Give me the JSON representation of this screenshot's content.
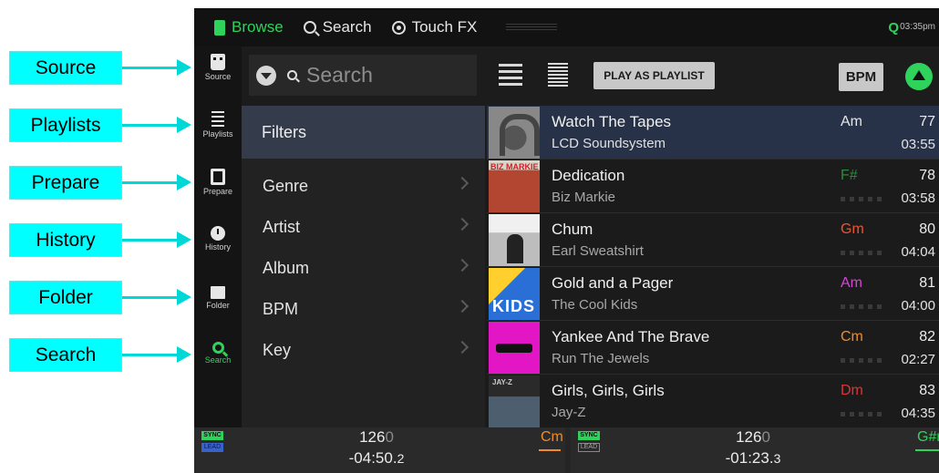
{
  "callouts": [
    {
      "label": "Source"
    },
    {
      "label": "Playlists"
    },
    {
      "label": "Prepare"
    },
    {
      "label": "History"
    },
    {
      "label": "Folder"
    },
    {
      "label": "Search"
    }
  ],
  "topbar": {
    "tabs": [
      {
        "label": "Browse",
        "icon": "library-icon"
      },
      {
        "label": "Search",
        "icon": "search-icon"
      },
      {
        "label": "Touch FX",
        "icon": "touch-fx-icon"
      }
    ],
    "quantize": "Q",
    "clock": "03:35pm"
  },
  "nav": {
    "items": [
      {
        "label": "Source",
        "icon": "source-icon"
      },
      {
        "label": "Playlists",
        "icon": "playlists-icon"
      },
      {
        "label": "Prepare",
        "icon": "prepare-icon"
      },
      {
        "label": "History",
        "icon": "history-icon"
      },
      {
        "label": "Folder",
        "icon": "folder-icon"
      },
      {
        "label": "Search",
        "icon": "search-icon",
        "active": true
      }
    ]
  },
  "toolbar": {
    "search_placeholder": "Search",
    "play_as_playlist": "PLAY AS PLAYLIST",
    "sort_label": "BPM"
  },
  "filters": {
    "title": "Filters",
    "items": [
      {
        "label": "Genre"
      },
      {
        "label": "Artist"
      },
      {
        "label": "Album"
      },
      {
        "label": "BPM"
      },
      {
        "label": "Key"
      }
    ]
  },
  "tracks": [
    {
      "title": "Watch The Tapes",
      "artist": "LCD Soundsystem",
      "key": "Am",
      "key_color": "#e6e6e6",
      "bpm": "77",
      "time": "03:55",
      "selected": true,
      "art_text": ""
    },
    {
      "title": "Dedication",
      "artist": "Biz Markie",
      "key": "F#",
      "key_color": "#2a8c3c",
      "bpm": "78",
      "time": "03:58",
      "selected": false,
      "art_text": "BIZ MARKIE"
    },
    {
      "title": "Chum",
      "artist": "Earl Sweatshirt",
      "key": "Gm",
      "key_color": "#e8562e",
      "bpm": "80",
      "time": "04:04",
      "selected": false,
      "art_text": ""
    },
    {
      "title": "Gold and a Pager",
      "artist": "The Cool Kids",
      "key": "Am",
      "key_color": "#d048d6",
      "bpm": "81",
      "time": "04:00",
      "selected": false,
      "art_text": "KIDS"
    },
    {
      "title": "Yankee And The Brave",
      "artist": "Run The Jewels",
      "key": "Cm",
      "key_color": "#f08a2a",
      "bpm": "82",
      "time": "02:27",
      "selected": false,
      "art_text": ""
    },
    {
      "title": "Girls, Girls, Girls",
      "artist": "Jay-Z",
      "key": "Dm",
      "key_color": "#e03434",
      "bpm": "83",
      "time": "04:35",
      "selected": false,
      "art_text": "JAY-Z"
    }
  ],
  "decks": [
    {
      "sync": "SYNC",
      "lead": "LEAD",
      "bpm_main": "126",
      "bpm_dec": "0",
      "time_main": "-04:50.",
      "time_dec": "2",
      "key": "Cm",
      "key_color": "#f08a2a"
    },
    {
      "sync": "SYNC",
      "lead": "LEAD",
      "bpm_main": "126",
      "bpm_dec": "0",
      "time_main": "-01:23.",
      "time_dec": "3",
      "key": "G#r",
      "key_color": "#2fd35b"
    }
  ]
}
